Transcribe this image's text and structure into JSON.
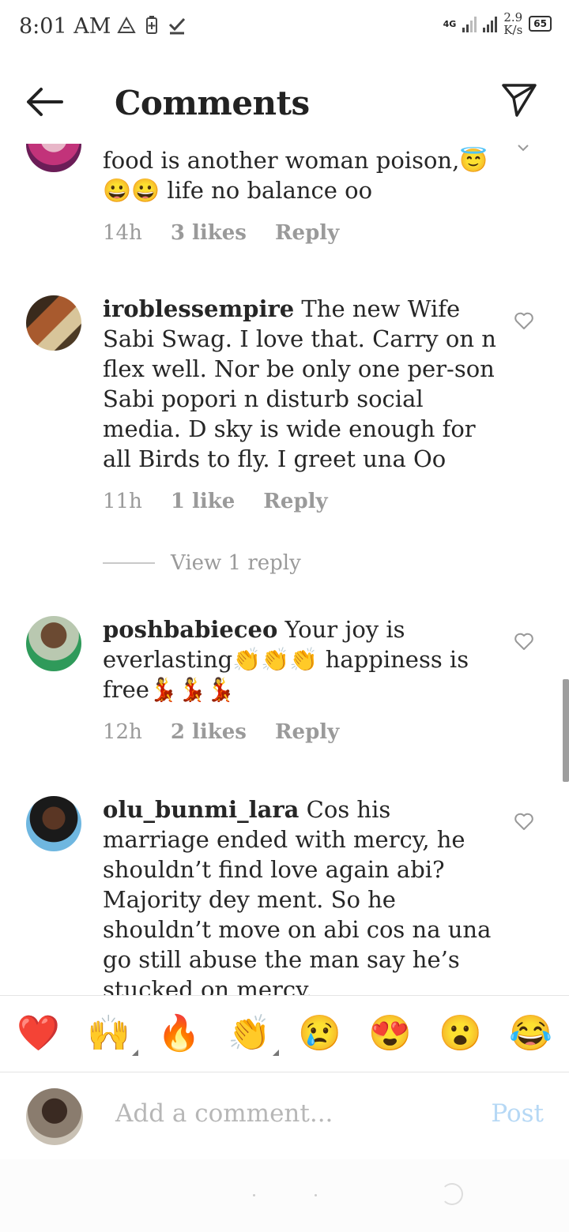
{
  "status_bar": {
    "time": "8:01 AM",
    "network": "4G",
    "speed_value": "2.9",
    "speed_unit": "K/s",
    "battery": "65",
    "icons": [
      "drive-icon",
      "battery-saver-icon",
      "check-icon",
      "signal-icon"
    ]
  },
  "header": {
    "title": "Comments",
    "back_icon": "back-arrow-icon",
    "share_icon": "send-icon"
  },
  "comments": [
    {
      "username": "",
      "text": "food is another woman poison,😇 😀😀 life no balance oo",
      "time": "14h",
      "likes": "3 likes",
      "reply": "Reply"
    },
    {
      "username": "iroblessempire",
      "text": " The new Wife Sabi Swag. I love that. Carry on n flex well. Nor be only one per-son Sabi popori n disturb social media. D sky is wide enough for all Birds to fly. I greet una Oo",
      "time": "11h",
      "likes": "1 like",
      "reply": "Reply",
      "view_replies": "View 1 reply"
    },
    {
      "username": "poshbabieceo",
      "text": " Your joy is everlasting👏👏👏 happiness is free💃💃💃",
      "time": "12h",
      "likes": "2 likes",
      "reply": "Reply"
    },
    {
      "username": "olu_bunmi_lara",
      "text": " Cos his marriage ended with mercy, he shouldn’t find love again abi? Majority dey ment. So he shouldn’t move on abi cos na una go still abuse the man say he’s stucked on mercy.",
      "time": "",
      "likes": "",
      "reply": ""
    }
  ],
  "reactions": [
    "❤️",
    "🙌",
    "🔥",
    "👏",
    "😢",
    "😍",
    "😮",
    "😂"
  ],
  "comment_input": {
    "placeholder": "Add a comment...",
    "post_label": "Post"
  },
  "colors": {
    "text": "#262626",
    "meta": "#9a9a9a",
    "post_disabled": "#b6d8f5"
  }
}
